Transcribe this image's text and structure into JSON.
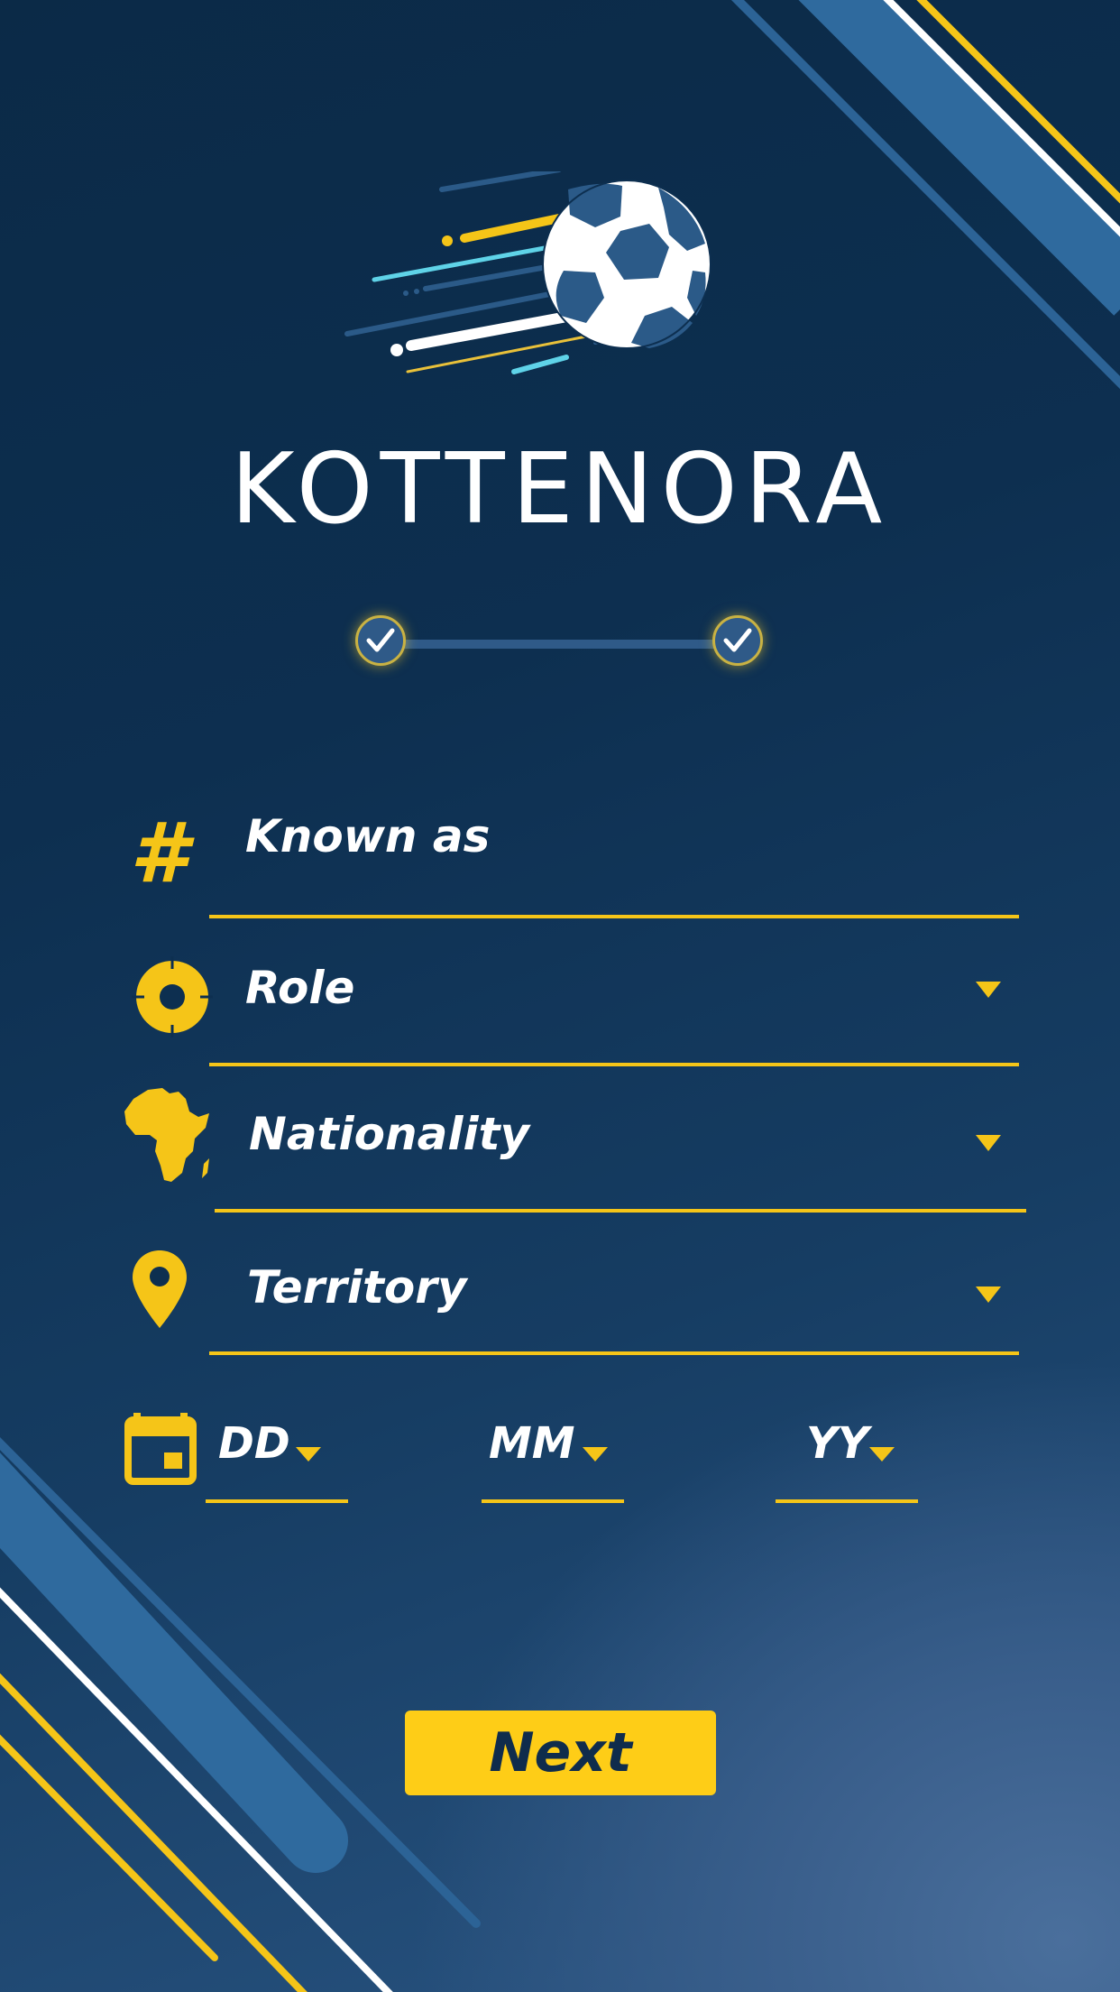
{
  "app": {
    "brand_name": "KOTTENORA"
  },
  "stepper": {
    "steps_total": 2,
    "steps_completed": 2
  },
  "form": {
    "known_as": {
      "placeholder": "Known as",
      "icon": "hash-icon"
    },
    "role": {
      "placeholder": "Role",
      "icon": "crosshair-icon"
    },
    "nationality": {
      "placeholder": "Nationality",
      "icon": "africa-map-icon"
    },
    "territory": {
      "placeholder": "Territory",
      "icon": "location-pin-icon"
    },
    "birthdate": {
      "icon": "calendar-icon",
      "day": "DD",
      "month": "MM",
      "year": "YY"
    }
  },
  "actions": {
    "next_label": "Next"
  },
  "colors": {
    "accent": "#f5c518",
    "background_dark": "#0b2a47",
    "background_light": "#3a5f8c",
    "button_text": "#0f2c4c",
    "stripe_blue": "#2f6a9e"
  }
}
